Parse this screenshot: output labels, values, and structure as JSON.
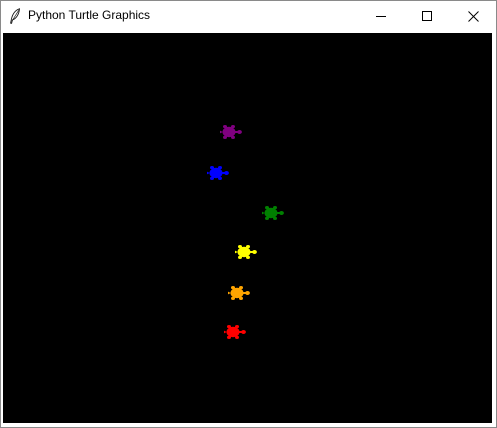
{
  "window": {
    "title": "Python Turtle Graphics",
    "icon": "feather-icon",
    "controls": [
      "minimize-icon",
      "maximize-icon",
      "close-icon"
    ]
  },
  "canvas": {
    "background": "#000000",
    "turtles": [
      {
        "name": "turtle-purple",
        "color": "#800080"
      },
      {
        "name": "turtle-blue",
        "color": "#0000ff"
      },
      {
        "name": "turtle-green",
        "color": "#008000"
      },
      {
        "name": "turtle-yellow",
        "color": "#ffff00"
      },
      {
        "name": "turtle-orange",
        "color": "#ffa500"
      },
      {
        "name": "turtle-red",
        "color": "#ff0000"
      }
    ]
  }
}
